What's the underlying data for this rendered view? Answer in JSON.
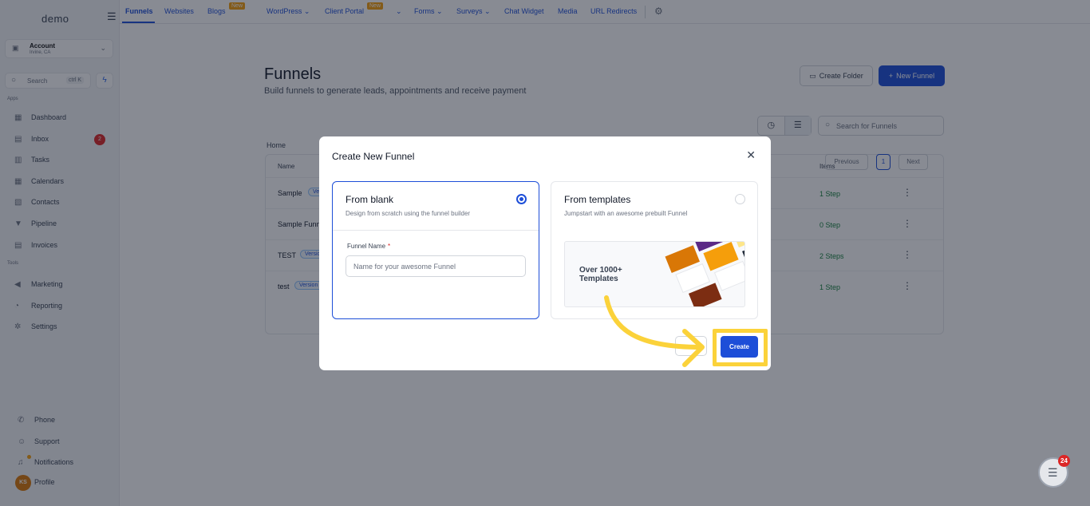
{
  "sidebar": {
    "logo": "demo",
    "account": {
      "name": "Account",
      "location": "Irvine, CA"
    },
    "search": {
      "label": "Search",
      "shortcut": "ctrl K"
    },
    "apps_label": "Apps",
    "tools_label": "Tools",
    "items": [
      {
        "label": "Dashboard",
        "icon": "dashboard-icon"
      },
      {
        "label": "Inbox",
        "icon": "inbox-icon",
        "badge": "2"
      },
      {
        "label": "Tasks",
        "icon": "tasks-icon"
      },
      {
        "label": "Calendars",
        "icon": "calendar-icon"
      },
      {
        "label": "Contacts",
        "icon": "contacts-icon"
      },
      {
        "label": "Pipeline",
        "icon": "pipeline-icon"
      },
      {
        "label": "Invoices",
        "icon": "invoice-icon"
      }
    ],
    "tools": [
      {
        "label": "Marketing",
        "icon": "megaphone-icon"
      },
      {
        "label": "Reporting",
        "icon": "chart-icon"
      },
      {
        "label": "Settings",
        "icon": "gear-icon"
      }
    ],
    "bottom": [
      {
        "label": "Phone",
        "icon": "phone-icon"
      },
      {
        "label": "Support",
        "icon": "support-icon"
      },
      {
        "label": "Notifications",
        "icon": "bell-icon"
      },
      {
        "label": "Profile",
        "icon": "avatar",
        "initials": "KS"
      }
    ]
  },
  "topnav": {
    "tabs": [
      {
        "label": "Funnels",
        "active": true
      },
      {
        "label": "Websites"
      },
      {
        "label": "Blogs",
        "badge": "New"
      },
      {
        "label": "WordPress ⌄"
      },
      {
        "label": "Client Portal",
        "badge": "New"
      },
      {
        "label": "⌄"
      },
      {
        "label": "Forms ⌄"
      },
      {
        "label": "Surveys ⌄"
      },
      {
        "label": "Chat Widget"
      },
      {
        "label": "Media"
      },
      {
        "label": "URL Redirects"
      }
    ]
  },
  "main": {
    "title": "Funnels",
    "subtitle": "Build funnels to generate leads, appointments and receive payment",
    "create_folder": "Create Folder",
    "new_funnel": "New Funnel",
    "search_placeholder": "Search for Funnels",
    "breadcrumb": "Home",
    "columns": {
      "name": "Name",
      "items": "Items"
    },
    "rows": [
      {
        "name": "Sample",
        "version": "Version 2",
        "steps": "1 Step"
      },
      {
        "name": "Sample Funnel",
        "version": "",
        "steps": "0 Step"
      },
      {
        "name": "TEST",
        "version": "Version 2",
        "steps": "2 Steps"
      },
      {
        "name": "test",
        "version": "Version 2",
        "steps": "1 Step"
      }
    ],
    "pagination": {
      "previous": "Previous",
      "current": "1",
      "next": "Next"
    }
  },
  "modal": {
    "title": "Create New Funnel",
    "blank": {
      "title": "From blank",
      "subtitle": "Design from scratch using the funnel builder",
      "selected": true
    },
    "field_label": "Funnel Name",
    "required_mark": "*",
    "field_placeholder": "Name for your awesome Funnel",
    "templates": {
      "title": "From templates",
      "subtitle": "Jumpstart with an awesome prebuilt Funnel",
      "preview_text": "Over 1000+ Templates"
    },
    "create": "Create"
  },
  "chat": {
    "badge": "24"
  },
  "colors": {
    "accent": "#1d4ed8",
    "highlight": "#fbd23a",
    "success": "#15803d",
    "danger": "#dc2626"
  }
}
